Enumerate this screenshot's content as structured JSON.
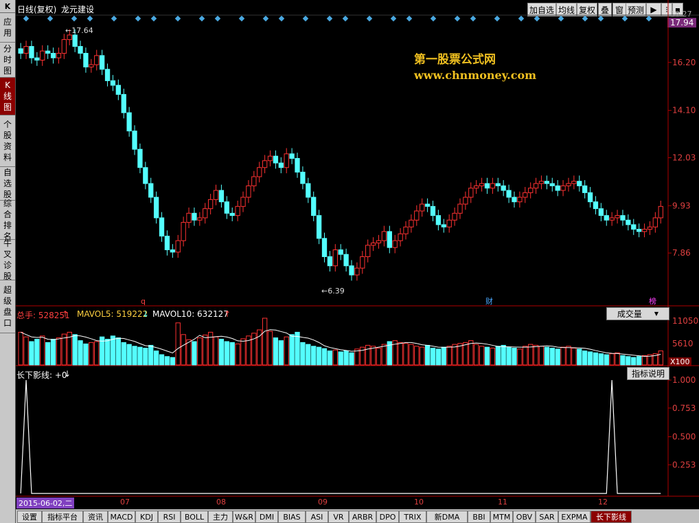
{
  "sidebar": {
    "top_icon": "K",
    "items": [
      {
        "label": [
          "应",
          "用"
        ],
        "active": false
      },
      {
        "label": [
          "分",
          "时",
          "图"
        ],
        "active": false
      },
      {
        "label": [
          "K",
          "线",
          "图"
        ],
        "active": true
      },
      {
        "label": [
          "个",
          "股",
          "资",
          "料"
        ],
        "active": false
      },
      {
        "label": [
          "自",
          "选",
          "股"
        ],
        "active": false
      },
      {
        "label": [
          "综",
          "合",
          "排",
          "名"
        ],
        "active": false
      },
      {
        "label": [
          "牛",
          "叉",
          "诊",
          "股"
        ],
        "active": false
      },
      {
        "label": [
          "超",
          "级",
          "盘",
          "口"
        ],
        "active": false
      }
    ]
  },
  "header": {
    "chart_mode": "日线(复权)",
    "stock_name": "龙元建设",
    "toolbar": [
      "加自选",
      "均线",
      "复权",
      "叠",
      "窗",
      "预测"
    ],
    "price_tag": "17.94",
    "price_axis_top": "18.27"
  },
  "watermark": {
    "line1": "第一股票公式网",
    "line2": "www.chnmoney.com"
  },
  "main_chart": {
    "high_label": "17.64",
    "low_label": "6.39",
    "marker_q": "q",
    "marker_cai": "财",
    "marker_bang": "榜",
    "y_ticks": [
      "16.20",
      "14.10",
      "12.03",
      "9.93",
      "7.86"
    ]
  },
  "volume_panel": {
    "label_total": "总手: 528251",
    "label_mavol5": "MAVOL5: 519222",
    "label_mavol10": "MAVOL10: 632127",
    "dropdown": "成交量",
    "y_ticks": [
      "11050",
      "5610"
    ],
    "unit": "X100"
  },
  "indicator_panel": {
    "label": "长下影线: +0",
    "help_button": "指标说明",
    "y_ticks": [
      "1.000",
      "0.753",
      "0.500",
      "0.253"
    ]
  },
  "x_axis": {
    "date_highlight": "2015-06-02,二",
    "months": [
      "07",
      "08",
      "09",
      "10",
      "11",
      "12"
    ]
  },
  "bottom_tabs": [
    "设置",
    "指标平台",
    "资讯",
    "MACD",
    "KDJ",
    "RSI",
    "BOLL",
    "主力",
    "W&R",
    "DMI",
    "BIAS",
    "ASI",
    "VR",
    "ARBR",
    "DPO",
    "TRIX",
    "新DMA",
    "BBI",
    "MTM",
    "OBV",
    "SAR",
    "EXPMA",
    "长下影线"
  ],
  "active_tab": "长下影线",
  "colors": {
    "up": "#ff3232",
    "down": "#54ffff",
    "axis": "#b00000",
    "diamond": "#4aa8e0",
    "watermark": "#f0c020"
  },
  "chart_data": {
    "type": "candlestick",
    "price_ylim": [
      6.0,
      18.27
    ],
    "closes": [
      16.6,
      16.9,
      16.4,
      16.3,
      16.7,
      16.6,
      16.4,
      16.6,
      17.2,
      17.4,
      16.9,
      16.6,
      16.0,
      16.1,
      16.5,
      15.9,
      15.4,
      15.2,
      14.8,
      14.0,
      13.2,
      12.4,
      11.6,
      10.9,
      10.3,
      9.4,
      8.6,
      8.0,
      7.9,
      8.4,
      9.2,
      9.6,
      9.3,
      9.4,
      9.8,
      10.2,
      10.6,
      10.1,
      9.6,
      9.5,
      9.9,
      10.3,
      10.8,
      11.2,
      11.6,
      11.9,
      12.1,
      11.8,
      11.6,
      12.2,
      12.0,
      11.4,
      10.9,
      10.3,
      9.5,
      8.5,
      7.7,
      7.3,
      8.0,
      7.8,
      7.3,
      6.9,
      7.2,
      7.7,
      8.2,
      8.3,
      8.4,
      8.8,
      8.1,
      8.4,
      8.7,
      9.0,
      9.3,
      9.7,
      10.0,
      9.9,
      9.5,
      9.1,
      9.0,
      9.3,
      9.6,
      10.0,
      10.3,
      10.7,
      10.8,
      10.9,
      10.7,
      10.9,
      10.8,
      10.6,
      10.3,
      10.1,
      10.3,
      10.5,
      10.7,
      10.9,
      11.0,
      10.9,
      10.8,
      10.6,
      10.8,
      10.9,
      11.0,
      10.8,
      10.5,
      10.1,
      9.8,
      9.5,
      9.3,
      9.4,
      9.5,
      9.3,
      9.1,
      8.9,
      8.8,
      8.9,
      9.0,
      9.4,
      9.9
    ],
    "volume": [
      70,
      60,
      50,
      55,
      62,
      48,
      55,
      58,
      66,
      70,
      65,
      52,
      45,
      48,
      50,
      60,
      55,
      62,
      58,
      48,
      44,
      40,
      38,
      36,
      42,
      30,
      22,
      18,
      16,
      90,
      65,
      54,
      50,
      58,
      64,
      70,
      60,
      55,
      50,
      48,
      45,
      56,
      62,
      68,
      75,
      100,
      72,
      58,
      52,
      60,
      65,
      70,
      48,
      44,
      40,
      38,
      35,
      30,
      32,
      28,
      30,
      26,
      34,
      38,
      42,
      40,
      36,
      44,
      50,
      52,
      48,
      46,
      44,
      40,
      38,
      42,
      36,
      34,
      38,
      40,
      44,
      46,
      48,
      52,
      44,
      40,
      38,
      36,
      40,
      42,
      38,
      36,
      34,
      40,
      44,
      42,
      40,
      38,
      36,
      34,
      38,
      40,
      36,
      34,
      30,
      28,
      26,
      24,
      22,
      24,
      26,
      20,
      18,
      16,
      18,
      20,
      22,
      24,
      30
    ],
    "indicator_spikes": [
      1,
      109
    ]
  }
}
